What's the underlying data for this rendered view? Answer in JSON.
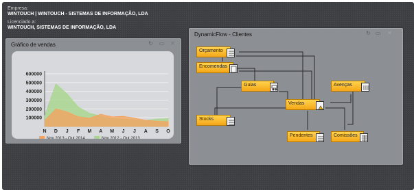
{
  "info": {
    "company_label": "Empresa:",
    "company_value": "WINTOUCH | WINTOUCH - SISTEMAS DE INFORMAÇÃO, LDA",
    "licensee_label": "Licenciado a:",
    "licensee_value": "WINTOUCH, SISTEMAS DE INFORMAÇÃO, LDA"
  },
  "sales_panel": {
    "title": "Gráfico de vendas",
    "buttons": [
      "refresh-icon",
      "minimize-icon",
      "close-icon"
    ]
  },
  "flow_panel": {
    "title": "DynamicFlow - Clientes",
    "buttons": [
      "refresh-icon",
      "minimize-icon",
      "close-icon"
    ],
    "nodes": {
      "orcamento": "Orçamento",
      "encomendas": "Encomendas",
      "guias": "Guias",
      "vendas": "Vendas",
      "avencas": "Avenças",
      "stocks": "Stocks",
      "pendentes": "Pendentes",
      "comissoes": "Comissões"
    }
  },
  "chart_data": {
    "type": "area",
    "categories": [
      "N",
      "D",
      "J",
      "F",
      "M",
      "A",
      "M",
      "J",
      "J",
      "A",
      "S",
      "O"
    ],
    "ylim": [
      0,
      600000
    ],
    "yticks": [
      "600000",
      "500000",
      "400000",
      "300000",
      "200000",
      "100000"
    ],
    "grid": true,
    "legend_position": "bottom",
    "series": [
      {
        "name": "Nov 2013 - Out 2014",
        "color": "#f4a460",
        "values": [
          70000,
          200000,
          165000,
          110000,
          95000,
          140000,
          110000,
          115000,
          95000,
          70000,
          60000,
          55000
        ]
      },
      {
        "name": "Nov 2012 - Out 2013",
        "color": "#a8d68c",
        "values": [
          120000,
          485000,
          370000,
          220000,
          150000,
          120000,
          90000,
          85000,
          75000,
          70000,
          85000,
          90000
        ]
      }
    ]
  }
}
